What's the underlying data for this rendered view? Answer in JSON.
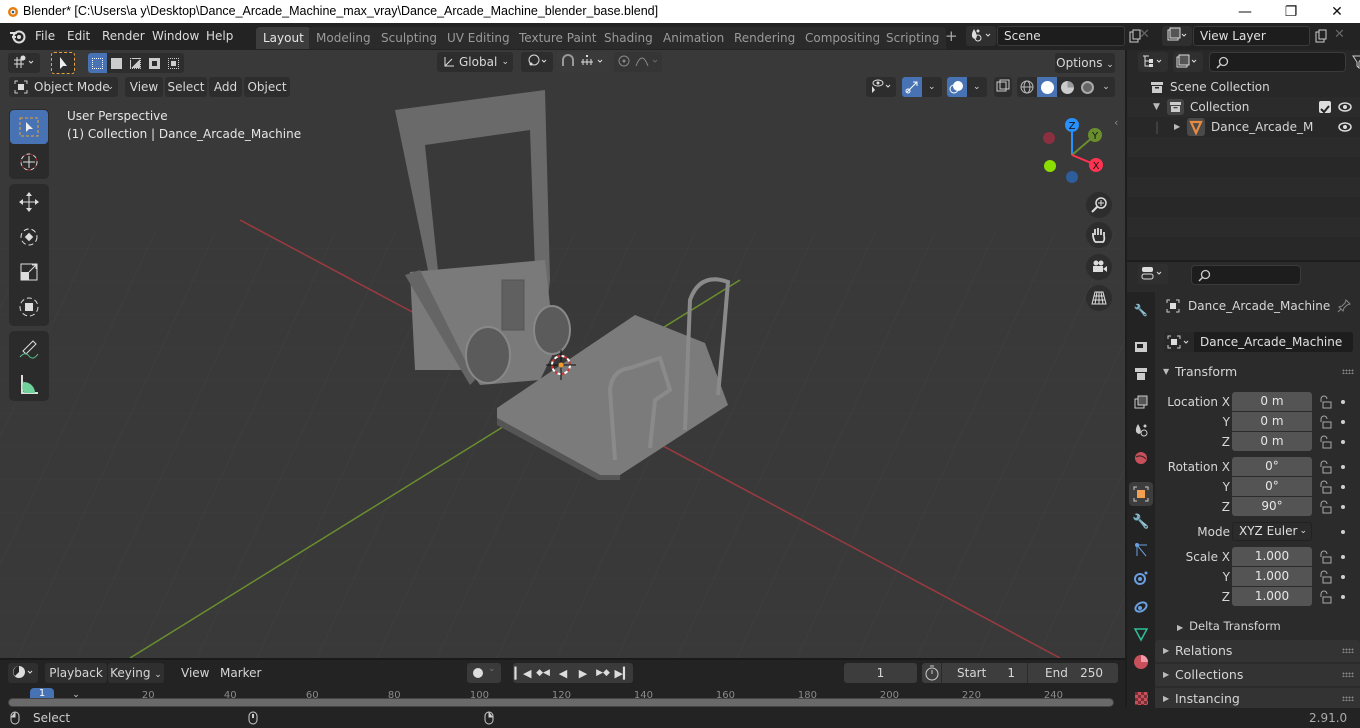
{
  "window": {
    "title": "Blender* [C:\\Users\\a y\\Desktop\\Dance_Arcade_Machine_max_vray\\Dance_Arcade_Machine_blender_base.blend]",
    "controls": [
      "minimize",
      "maximize",
      "close"
    ]
  },
  "menubar": {
    "items": [
      "File",
      "Edit",
      "Render",
      "Window",
      "Help"
    ]
  },
  "workspaces": {
    "tabs": [
      "Layout",
      "Modeling",
      "Sculpting",
      "UV Editing",
      "Texture Paint",
      "Shading",
      "Animation",
      "Rendering",
      "Compositing",
      "Scripting"
    ],
    "active": "Layout",
    "add_label": "+"
  },
  "scene": {
    "name": "Scene"
  },
  "view_layer": {
    "name": "View Layer"
  },
  "viewport": {
    "transform_orientation": "Global",
    "options_label": "Options",
    "mode": "Object Mode",
    "menus": [
      "View",
      "Select",
      "Add",
      "Object"
    ],
    "overlay_title": "User Perspective",
    "overlay_subtitle": "(1) Collection | Dance_Arcade_Machine",
    "gizmo_axes": {
      "x": "X",
      "y": "Y",
      "z": "Z"
    },
    "axis_colors": {
      "x": "#ff3352",
      "y": "#8bdc00",
      "z": "#2890ff"
    }
  },
  "outliner": {
    "rows": [
      {
        "label": "Scene Collection",
        "type": "scene-collection"
      },
      {
        "label": "Collection",
        "type": "collection",
        "checked": true,
        "visible": true
      },
      {
        "label": "Dance_Arcade_Mach",
        "type": "object",
        "visible": true
      }
    ]
  },
  "properties": {
    "object_name": "Dance_Arcade_Machine",
    "datablock_name": "Dance_Arcade_Machine",
    "transform": {
      "title": "Transform",
      "location": {
        "label": "Location X",
        "x": "0 m",
        "y": "0 m",
        "z": "0 m"
      },
      "rotation": {
        "label": "Rotation X",
        "x": "0°",
        "y": "0°",
        "z": "90°"
      },
      "mode_label": "Mode",
      "mode": "XYZ Euler",
      "scale": {
        "label": "Scale X",
        "x": "1.000",
        "y": "1.000",
        "z": "1.000"
      },
      "axis_labels": {
        "y": "Y",
        "z": "Z"
      },
      "delta": "Delta Transform"
    },
    "panels": [
      "Relations",
      "Collections",
      "Instancing"
    ]
  },
  "timeline": {
    "menus": [
      "Playback",
      "Keying",
      "View",
      "Marker"
    ],
    "current_frame": "1",
    "start_label": "Start",
    "start": "1",
    "end_label": "End",
    "end": "250",
    "ruler_ticks": [
      "20",
      "40",
      "60",
      "80",
      "100",
      "120",
      "140",
      "160",
      "180",
      "200",
      "220",
      "240"
    ],
    "playhead": "1"
  },
  "statusbar": {
    "left_hint": "Select",
    "version": "2.91.0"
  }
}
